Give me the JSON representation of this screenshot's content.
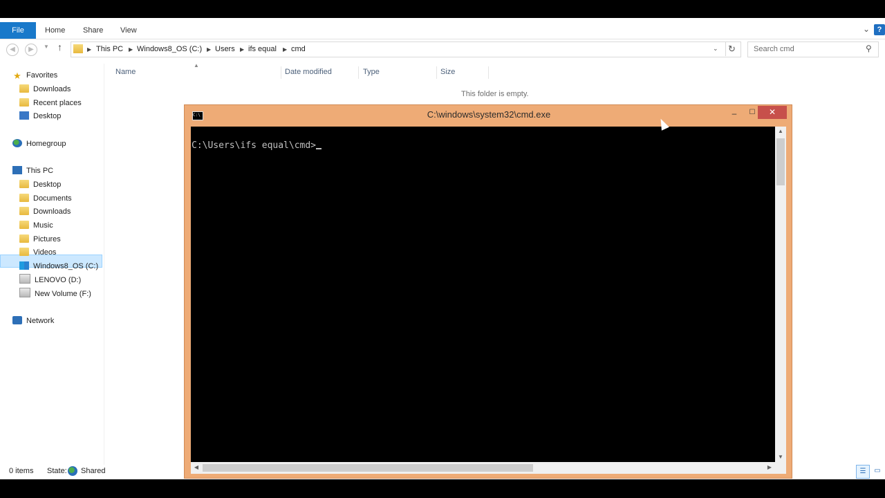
{
  "ribbon": {
    "tabs": [
      "File",
      "Home",
      "Share",
      "View"
    ],
    "help": "?"
  },
  "address": {
    "crumbs": [
      "This PC",
      "Windows8_OS (C:)",
      "Users",
      "ifs equal",
      "cmd"
    ]
  },
  "search": {
    "placeholder": "Search cmd"
  },
  "sidebar": {
    "favorites": "Favorites",
    "fav_items": [
      "Downloads",
      "Recent places",
      "Desktop"
    ],
    "homegroup": "Homegroup",
    "this_pc": "This PC",
    "pc_items": [
      "Desktop",
      "Documents",
      "Downloads",
      "Music",
      "Pictures",
      "Videos",
      "Windows8_OS (C:)",
      "LENOVO (D:)",
      "New Volume (F:)"
    ],
    "network": "Network"
  },
  "columns": [
    "Name",
    "Date modified",
    "Type",
    "Size"
  ],
  "empty_message": "This folder is empty.",
  "status": {
    "items": "0 items",
    "state_label": "State:",
    "state_value": "Shared"
  },
  "cmd": {
    "title": "C:\\windows\\system32\\cmd.exe",
    "icon_text": "C:\\",
    "prompt": "C:\\Users\\ifs equal\\cmd>"
  }
}
